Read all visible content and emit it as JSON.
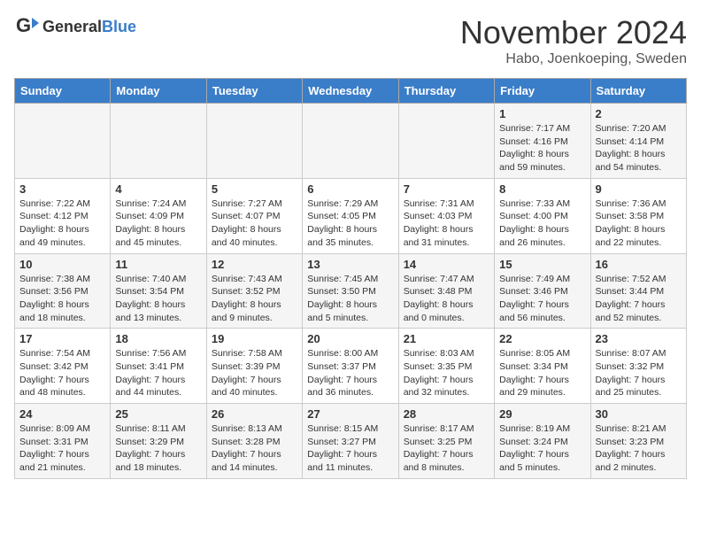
{
  "header": {
    "logo_general": "General",
    "logo_blue": "Blue",
    "month": "November 2024",
    "location": "Habo, Joenkoeping, Sweden"
  },
  "days_of_week": [
    "Sunday",
    "Monday",
    "Tuesday",
    "Wednesday",
    "Thursday",
    "Friday",
    "Saturday"
  ],
  "weeks": [
    [
      {
        "day": "",
        "info": ""
      },
      {
        "day": "",
        "info": ""
      },
      {
        "day": "",
        "info": ""
      },
      {
        "day": "",
        "info": ""
      },
      {
        "day": "",
        "info": ""
      },
      {
        "day": "1",
        "info": "Sunrise: 7:17 AM\nSunset: 4:16 PM\nDaylight: 8 hours\nand 59 minutes."
      },
      {
        "day": "2",
        "info": "Sunrise: 7:20 AM\nSunset: 4:14 PM\nDaylight: 8 hours\nand 54 minutes."
      }
    ],
    [
      {
        "day": "3",
        "info": "Sunrise: 7:22 AM\nSunset: 4:12 PM\nDaylight: 8 hours\nand 49 minutes."
      },
      {
        "day": "4",
        "info": "Sunrise: 7:24 AM\nSunset: 4:09 PM\nDaylight: 8 hours\nand 45 minutes."
      },
      {
        "day": "5",
        "info": "Sunrise: 7:27 AM\nSunset: 4:07 PM\nDaylight: 8 hours\nand 40 minutes."
      },
      {
        "day": "6",
        "info": "Sunrise: 7:29 AM\nSunset: 4:05 PM\nDaylight: 8 hours\nand 35 minutes."
      },
      {
        "day": "7",
        "info": "Sunrise: 7:31 AM\nSunset: 4:03 PM\nDaylight: 8 hours\nand 31 minutes."
      },
      {
        "day": "8",
        "info": "Sunrise: 7:33 AM\nSunset: 4:00 PM\nDaylight: 8 hours\nand 26 minutes."
      },
      {
        "day": "9",
        "info": "Sunrise: 7:36 AM\nSunset: 3:58 PM\nDaylight: 8 hours\nand 22 minutes."
      }
    ],
    [
      {
        "day": "10",
        "info": "Sunrise: 7:38 AM\nSunset: 3:56 PM\nDaylight: 8 hours\nand 18 minutes."
      },
      {
        "day": "11",
        "info": "Sunrise: 7:40 AM\nSunset: 3:54 PM\nDaylight: 8 hours\nand 13 minutes."
      },
      {
        "day": "12",
        "info": "Sunrise: 7:43 AM\nSunset: 3:52 PM\nDaylight: 8 hours\nand 9 minutes."
      },
      {
        "day": "13",
        "info": "Sunrise: 7:45 AM\nSunset: 3:50 PM\nDaylight: 8 hours\nand 5 minutes."
      },
      {
        "day": "14",
        "info": "Sunrise: 7:47 AM\nSunset: 3:48 PM\nDaylight: 8 hours\nand 0 minutes."
      },
      {
        "day": "15",
        "info": "Sunrise: 7:49 AM\nSunset: 3:46 PM\nDaylight: 7 hours\nand 56 minutes."
      },
      {
        "day": "16",
        "info": "Sunrise: 7:52 AM\nSunset: 3:44 PM\nDaylight: 7 hours\nand 52 minutes."
      }
    ],
    [
      {
        "day": "17",
        "info": "Sunrise: 7:54 AM\nSunset: 3:42 PM\nDaylight: 7 hours\nand 48 minutes."
      },
      {
        "day": "18",
        "info": "Sunrise: 7:56 AM\nSunset: 3:41 PM\nDaylight: 7 hours\nand 44 minutes."
      },
      {
        "day": "19",
        "info": "Sunrise: 7:58 AM\nSunset: 3:39 PM\nDaylight: 7 hours\nand 40 minutes."
      },
      {
        "day": "20",
        "info": "Sunrise: 8:00 AM\nSunset: 3:37 PM\nDaylight: 7 hours\nand 36 minutes."
      },
      {
        "day": "21",
        "info": "Sunrise: 8:03 AM\nSunset: 3:35 PM\nDaylight: 7 hours\nand 32 minutes."
      },
      {
        "day": "22",
        "info": "Sunrise: 8:05 AM\nSunset: 3:34 PM\nDaylight: 7 hours\nand 29 minutes."
      },
      {
        "day": "23",
        "info": "Sunrise: 8:07 AM\nSunset: 3:32 PM\nDaylight: 7 hours\nand 25 minutes."
      }
    ],
    [
      {
        "day": "24",
        "info": "Sunrise: 8:09 AM\nSunset: 3:31 PM\nDaylight: 7 hours\nand 21 minutes."
      },
      {
        "day": "25",
        "info": "Sunrise: 8:11 AM\nSunset: 3:29 PM\nDaylight: 7 hours\nand 18 minutes."
      },
      {
        "day": "26",
        "info": "Sunrise: 8:13 AM\nSunset: 3:28 PM\nDaylight: 7 hours\nand 14 minutes."
      },
      {
        "day": "27",
        "info": "Sunrise: 8:15 AM\nSunset: 3:27 PM\nDaylight: 7 hours\nand 11 minutes."
      },
      {
        "day": "28",
        "info": "Sunrise: 8:17 AM\nSunset: 3:25 PM\nDaylight: 7 hours\nand 8 minutes."
      },
      {
        "day": "29",
        "info": "Sunrise: 8:19 AM\nSunset: 3:24 PM\nDaylight: 7 hours\nand 5 minutes."
      },
      {
        "day": "30",
        "info": "Sunrise: 8:21 AM\nSunset: 3:23 PM\nDaylight: 7 hours\nand 2 minutes."
      }
    ]
  ]
}
